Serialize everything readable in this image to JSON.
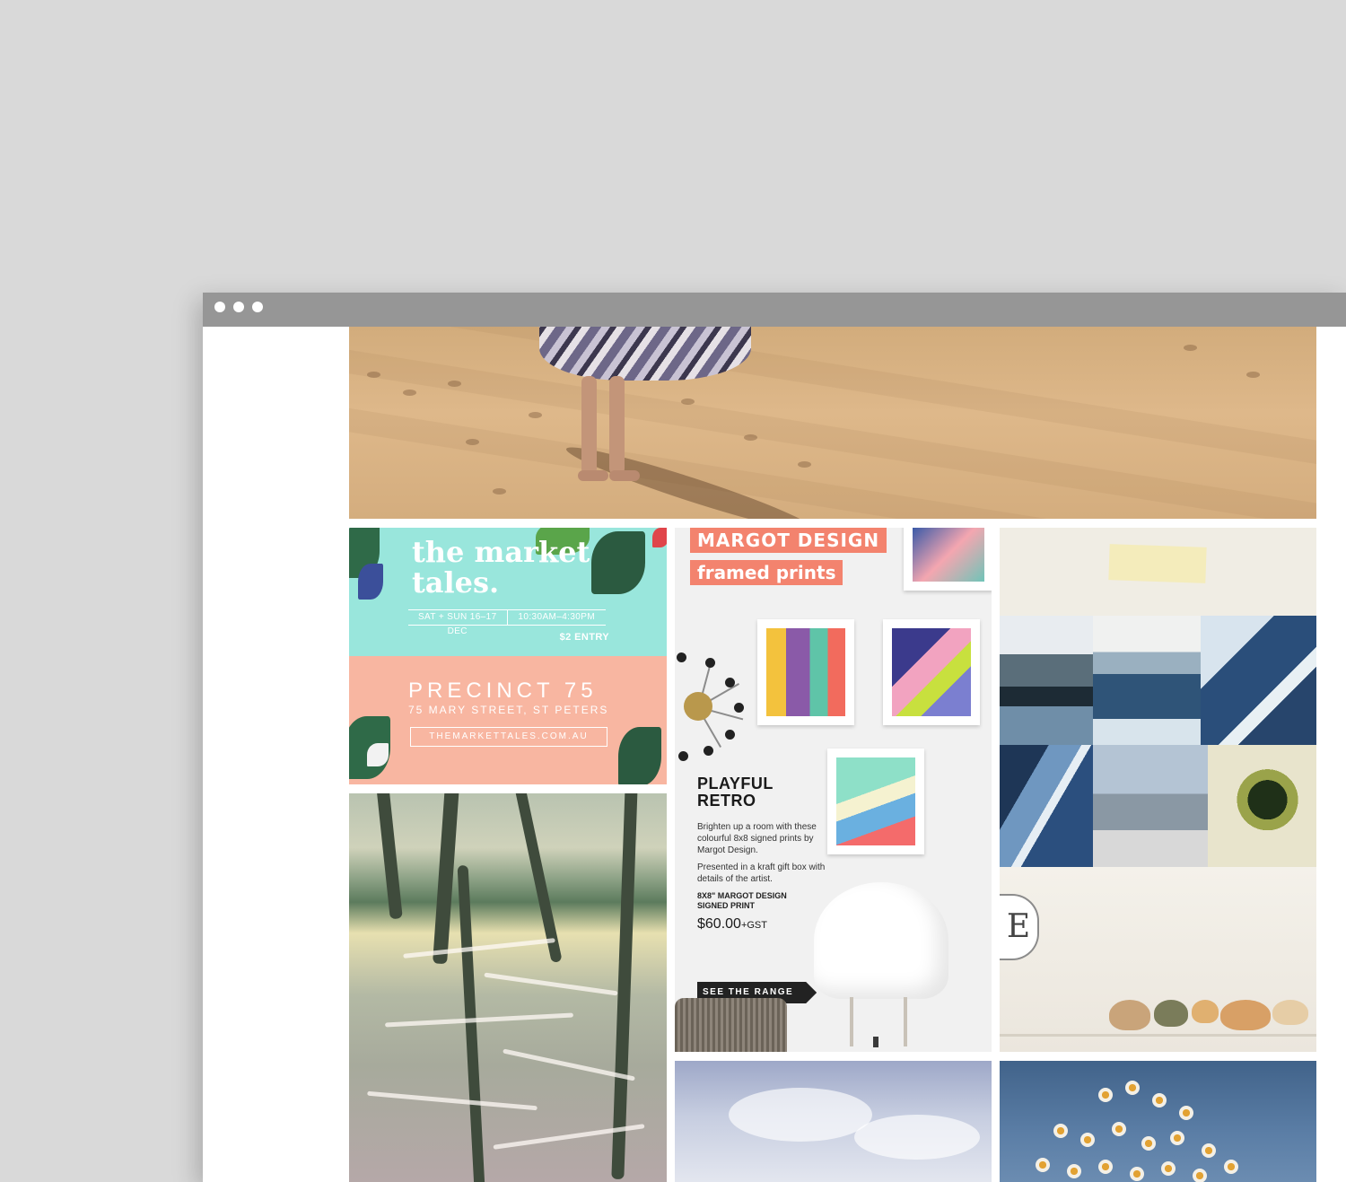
{
  "browser": {
    "window_dots": [
      "close",
      "minimize",
      "maximize"
    ]
  },
  "tiles": {
    "hero": {
      "description_icon": "beach-photo-icon"
    },
    "market_tales": {
      "title": "the market tales.",
      "date": "SAT + SUN 16–17 DEC",
      "time": "10:30AM–4:30PM",
      "entry": "$2 ENTRY",
      "venue": "PRECINCT 75",
      "address": "75 MARY STREET, ST PETERS",
      "url": "THEMARKETTALES.COM.AU"
    },
    "margot": {
      "badge_1": "MARGOT DESIGN",
      "badge_2": "framed prints",
      "heading_line_1": "PLAYFUL",
      "heading_line_2": "RETRO",
      "paragraph_1": "Brighten up a room with these colourful 8x8 signed prints by Margot Design.",
      "paragraph_2": "Presented in a kraft gift box with details of the artist.",
      "product_label_line_1": "8X8\" MARGOT DESIGN",
      "product_label_line_2": "SIGNED PRINT",
      "price": "$60.00",
      "price_suffix": "+GST",
      "cta": "SEE THE RANGE"
    },
    "coast": {
      "plaque_letter": "E"
    }
  },
  "colors": {
    "page_background": "#d9d9d9",
    "titlebar": "#969696",
    "market_mint": "#99e6dc",
    "market_peach": "#f8b6a1",
    "margot_coral": "#f3836e"
  }
}
